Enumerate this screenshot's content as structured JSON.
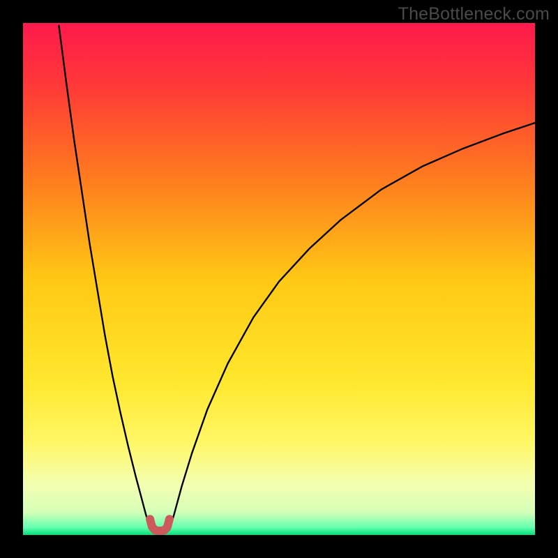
{
  "watermark": "TheBottleneck.com",
  "chart_data": {
    "type": "line",
    "title": "",
    "xlabel": "",
    "ylabel": "",
    "xlim": [
      0,
      100
    ],
    "ylim": [
      0,
      100
    ],
    "grid": false,
    "legend": "none",
    "annotations": [],
    "background_gradient_stops": [
      {
        "pos": 0.0,
        "color": "#ff1a4d"
      },
      {
        "pos": 0.12,
        "color": "#ff3838"
      },
      {
        "pos": 0.3,
        "color": "#ff7a1f"
      },
      {
        "pos": 0.5,
        "color": "#ffc814"
      },
      {
        "pos": 0.7,
        "color": "#ffe72d"
      },
      {
        "pos": 0.82,
        "color": "#fff766"
      },
      {
        "pos": 0.9,
        "color": "#f3ffb0"
      },
      {
        "pos": 0.955,
        "color": "#d6ffb8"
      },
      {
        "pos": 0.985,
        "color": "#66ffb0"
      },
      {
        "pos": 1.0,
        "color": "#00e079"
      }
    ],
    "series": [
      {
        "name": "bottleneck-curve-left",
        "stroke": "#000000",
        "x": [
          7.0,
          8.5,
          10.0,
          11.5,
          13.0,
          14.5,
          16.0,
          17.5,
          19.0,
          20.5,
          22.0,
          23.2,
          24.0,
          24.6,
          25.0
        ],
        "y": [
          99.5,
          88.0,
          77.0,
          67.0,
          57.0,
          48.0,
          39.0,
          31.0,
          24.0,
          17.5,
          11.5,
          7.0,
          4.0,
          2.0,
          1.0
        ]
      },
      {
        "name": "bottleneck-curve-right",
        "stroke": "#000000",
        "x": [
          28.6,
          29.5,
          31.0,
          33.0,
          36.0,
          40.0,
          45.0,
          50.0,
          56.0,
          62.0,
          70.0,
          78.0,
          86.0,
          94.0,
          100.0
        ],
        "y": [
          1.0,
          4.0,
          9.5,
          16.0,
          24.5,
          33.5,
          42.5,
          49.5,
          56.0,
          61.5,
          67.5,
          72.0,
          75.5,
          78.5,
          80.5
        ]
      },
      {
        "name": "minimum-marker",
        "stroke": "#cc5a5a",
        "stroke_width": 12,
        "x": [
          24.8,
          25.2,
          25.8,
          26.7,
          27.6,
          28.2,
          28.6
        ],
        "y": [
          3.1,
          1.6,
          0.9,
          0.8,
          0.9,
          1.6,
          3.1
        ]
      }
    ]
  }
}
